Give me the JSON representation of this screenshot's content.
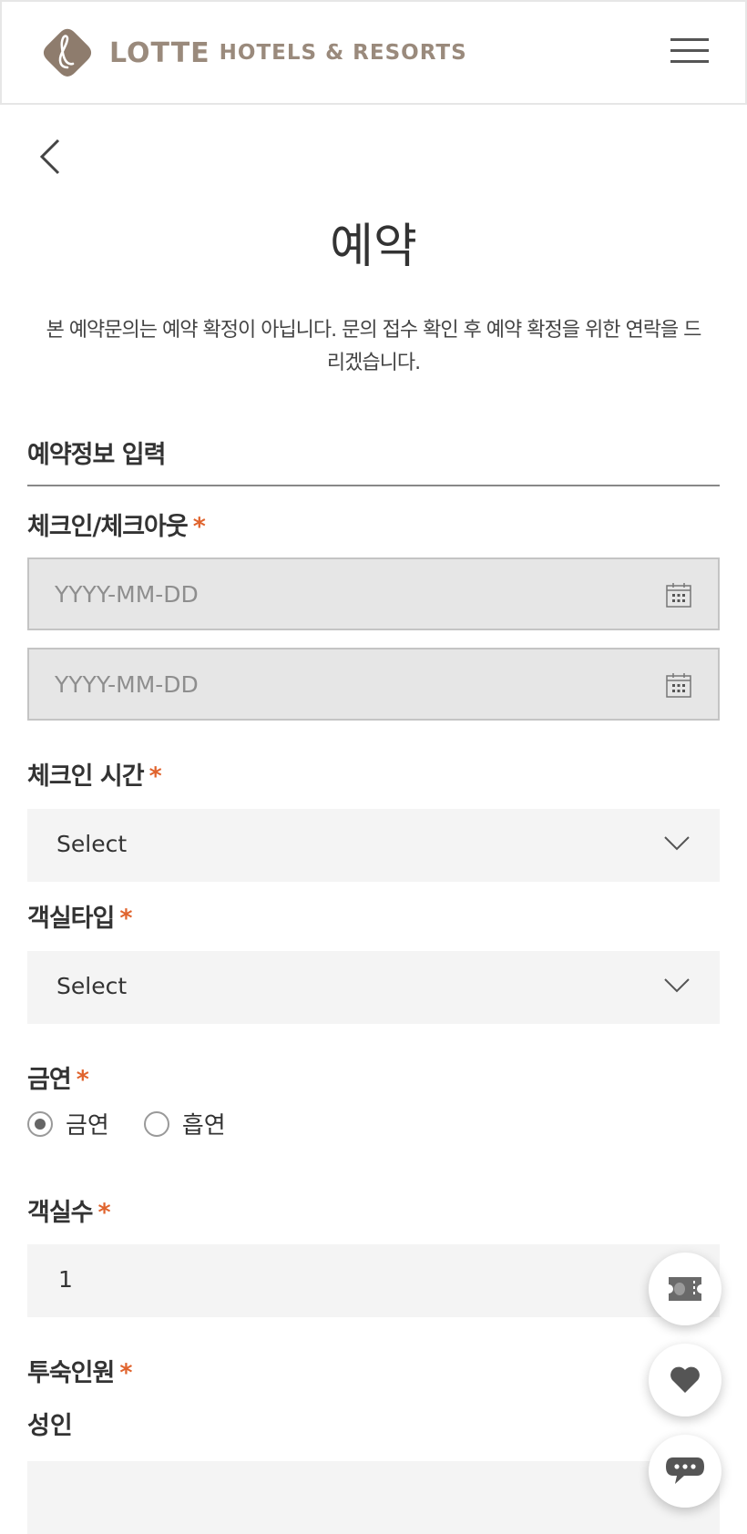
{
  "header": {
    "brand_main": "LOTTE",
    "brand_sub": "HOTELS & RESORTS"
  },
  "page": {
    "title": "예약",
    "notice": "본 예약문의는 예약 확정이 아닙니다. 문의 접수 확인 후 예약 확정을 위한 연락을 드리겠습니다."
  },
  "form": {
    "section_title": "예약정보 입력",
    "required_mark": "*",
    "checkin_checkout": {
      "label": "체크인/체크아웃",
      "checkin_placeholder": "YYYY-MM-DD",
      "checkout_placeholder": "YYYY-MM-DD"
    },
    "checkin_time": {
      "label": "체크인 시간",
      "value": "Select"
    },
    "room_type": {
      "label": "객실타입",
      "value": "Select"
    },
    "smoking": {
      "label": "금연",
      "options": [
        {
          "label": "금연",
          "selected": true
        },
        {
          "label": "흡연",
          "selected": false
        }
      ]
    },
    "room_count": {
      "label": "객실수",
      "value": "1"
    },
    "guests": {
      "label": "투숙인원",
      "adult_label": "성인",
      "adult_value": ""
    }
  },
  "floating": {
    "coupon_icon": "coupon-ticket-icon",
    "wishlist_icon": "heart-icon",
    "chat_icon": "chat-bubble-icon"
  },
  "colors": {
    "brand": "#9a8a7c",
    "required": "#e0642e",
    "field_bg": "#f4f4f4",
    "date_field_bg": "#e6e6e6"
  }
}
